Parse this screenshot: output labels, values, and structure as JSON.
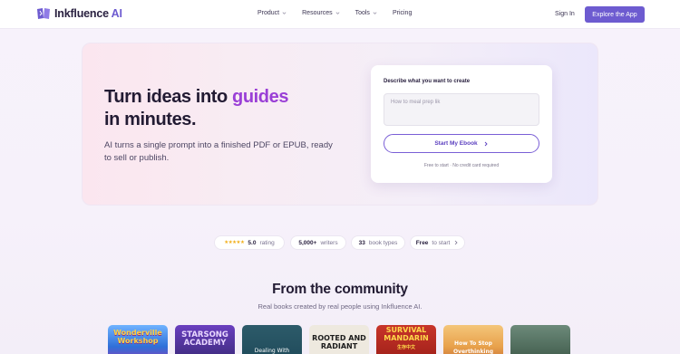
{
  "brand": {
    "name": "Inkfluence",
    "suffix": "AI"
  },
  "nav": {
    "items": [
      {
        "label": "Product",
        "has_dropdown": true
      },
      {
        "label": "Resources",
        "has_dropdown": true
      },
      {
        "label": "Tools",
        "has_dropdown": true
      },
      {
        "label": "Pricing",
        "has_dropdown": false
      }
    ],
    "signin_label": "Sign In",
    "cta_label": "Explore the App"
  },
  "hero": {
    "title_part1": "Turn ideas into ",
    "title_accent": "guides",
    "title_part2": "in minutes.",
    "subtitle": "AI turns a single prompt into a finished PDF or EPUB, ready to sell or publish."
  },
  "form": {
    "label": "Describe what you want to create",
    "input_placeholder": "How to meal prep lik",
    "input_value": "",
    "button_label": "Start My Ebook",
    "note": "Free to start · No credit card required"
  },
  "stats": [
    {
      "value": "5.0",
      "label": "rating",
      "stars": 5
    },
    {
      "value": "5,000+",
      "label": "writers"
    },
    {
      "value": "33",
      "label": "book types"
    },
    {
      "value": "Free",
      "label": "to start",
      "has_chevron": true
    }
  ],
  "community": {
    "title": "From the community",
    "subtitle": "Real books created by real people using Inkfluence AI.",
    "books": [
      {
        "title": "Wonderville Workshop",
        "bg": "#2f6fd8",
        "color": "#ffd23f"
      },
      {
        "title": "STARSONG ACADEMY",
        "bg": "#3b2a7a",
        "color": "#e9d8ff"
      },
      {
        "title": "Dealing With",
        "bg": "#1f4a5a",
        "color": "#ffffff"
      },
      {
        "title": "ROOTED AND RADIANT",
        "bg": "#e9e4da",
        "color": "#1d1d1d"
      },
      {
        "title": "SURVIVAL MANDARIN",
        "bg": "#b3261e",
        "color": "#ffd84a",
        "subtitle": "生存中文"
      },
      {
        "title": "How To Stop Overthinking",
        "bg": "#e8a14b",
        "color": "#ffffff"
      },
      {
        "title": "",
        "bg": "#3f5a4a",
        "color": "#ffffff"
      }
    ]
  },
  "colors": {
    "accent": "#6d5bd0",
    "highlight": "#9a3fd6",
    "star": "#f2b01e"
  }
}
